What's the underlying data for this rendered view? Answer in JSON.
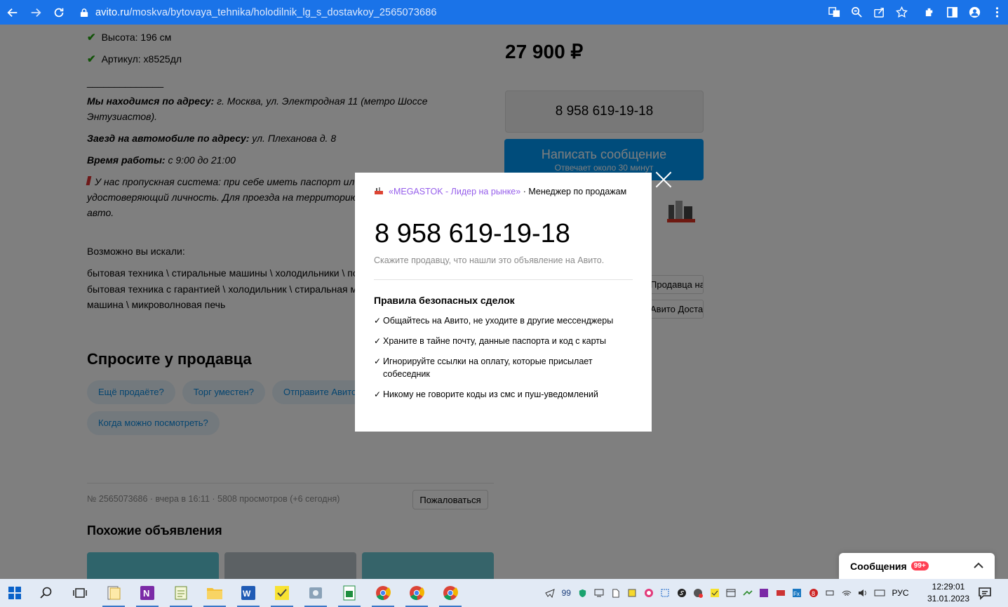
{
  "browser": {
    "url_host": "avito.ru",
    "url_path": "/moskva/bytovaya_tehnika/holodilnik_lg_s_dostavkoy_2565073686"
  },
  "specs": [
    {
      "label": "Высота: 196 см"
    },
    {
      "label": "Артикул: x8525дл"
    }
  ],
  "separator": "______________",
  "address": {
    "addr_label": "Мы находимся по адресу:",
    "addr_value": " г. Москва, ул. Электродная 11 (метро Шоссе Энтузиастов).",
    "car_label": "Заезд на автомобиле по адресу:",
    "car_value": " ул. Плеханова д. 8",
    "hours_label": "Время работы:",
    "hours_value": " с 9:00 до 21:00",
    "pass_text": "У нас пропускная система: при себе иметь паспорт или иной документ, удостоверяющий личность. Для проезда на территорию заранее сообщить номер авто."
  },
  "may_search": {
    "title": "Возможно вы искали:",
    "line1": "бытовая техника \\ стиральные машины \\ холодильники \\ посудомоечная",
    "line2": "бытовая техника с гарантией \\ холодильник \\ стиральная машина \\ посудомоечная",
    "line3": "машина \\ микроволновая печь"
  },
  "ask": {
    "title": "Спросите у продавца",
    "chips": [
      "Ещё продаёте?",
      "Торг уместен?",
      "Отправите Авито Доставкой?",
      "Когда можно посмотреть?"
    ]
  },
  "listing_info": {
    "text": "№ 2565073686 · вчера в 16:11 · 5808 просмотров (+6 сегодня)",
    "report": "Пожаловаться"
  },
  "similar_title": "Похожие объявления",
  "right": {
    "price": "27 900 ₽",
    "phone": "8 958 619-19-18",
    "message": "Написать сообщение",
    "message_sub": "Отвечает около 30 минут",
    "field1": "Продавца на связи с покупателя",
    "field2": "Авито Доставка"
  },
  "modal": {
    "seller": "«MEGASTOK - Лидер на рынке»",
    "role": " · Менеджер по продажам",
    "phone": "8 958 619-19-18",
    "hint": "Скажите продавцу, что нашли это объявление на Авито.",
    "rules_title": "Правила безопасных сделок",
    "rules": [
      "Общайтесь на Авито, не уходите в другие мессенджеры",
      "Храните в тайне почту, данные паспорта и код с карты",
      "Игнорируйте ссылки на оплату, которые присылает собеседник",
      "Никому не говорите коды из смс и пуш-уведомлений"
    ]
  },
  "chat": {
    "label": "Сообщения",
    "badge": "99+"
  },
  "taskbar": {
    "tray_count": "99",
    "lang": "РУС",
    "time": "12:29:01",
    "date": "31.01.2023"
  }
}
